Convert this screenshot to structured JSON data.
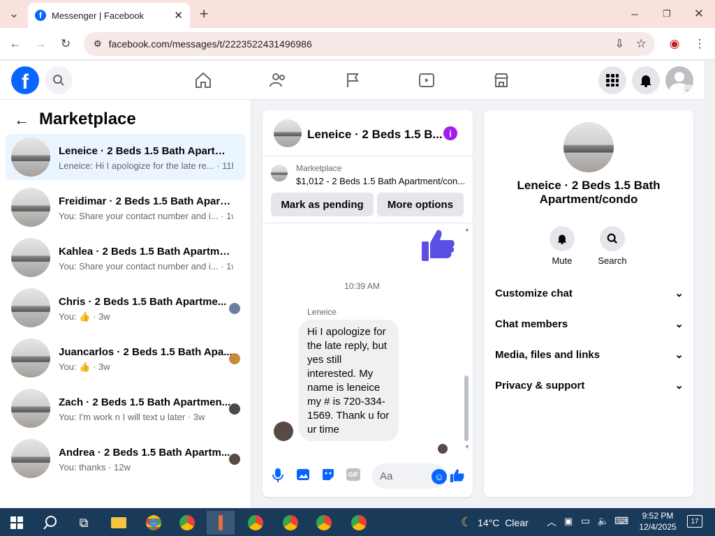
{
  "browser": {
    "tab_title": "Messenger | Facebook",
    "url": "facebook.com/messages/t/2223522431496986"
  },
  "sidebar": {
    "title": "Marketplace",
    "rows": [
      {
        "title": "Leneice · 2 Beds 1.5 Bath Apartme...",
        "preview": "Leneice: Hi I apologize for the late re...",
        "time": "· 11h"
      },
      {
        "title": "Freidimar · 2 Beds 1.5 Bath Apartm...",
        "preview": "You: Share your contact number and i...",
        "time": "· 1w"
      },
      {
        "title": "Kahlea · 2 Beds 1.5 Bath Apartmen...",
        "preview": "You: Share your contact number and i...",
        "time": "· 1w"
      },
      {
        "title": "Chris · 2 Beds 1.5 Bath Apartme...",
        "preview": "You:",
        "time": "· 3w"
      },
      {
        "title": "Juancarlos · 2 Beds 1.5 Bath Apa...",
        "preview": "You:",
        "time": "· 3w"
      },
      {
        "title": "Zach · 2 Beds 1.5 Bath Apartmen...",
        "preview": "You: I'm work n I will text u later",
        "time": "· 3w"
      },
      {
        "title": "Andrea · 2 Beds 1.5 Bath Apartm...",
        "preview": "You: thanks",
        "time": "· 12w"
      }
    ]
  },
  "chat": {
    "header": "Leneice · 2 Beds 1.5 B...",
    "listing_source": "Marketplace",
    "listing_price": "$1,012 - 2 Beds 1.5 Bath Apartment/con...",
    "mark_pending": "Mark as pending",
    "more_options": "More options",
    "timestamp": "10:39 AM",
    "sender": "Leneice",
    "message": "Hi I apologize for the late reply, but yes still interested.  My name is leneice my # is 720-334-1569.  Thank u for ur time",
    "input_placeholder": "Aa"
  },
  "info": {
    "name": "Leneice · 2 Beds 1.5 Bath Apartment/condo",
    "mute": "Mute",
    "search": "Search",
    "sections": [
      "Customize chat",
      "Chat members",
      "Media, files and links",
      "Privacy & support"
    ]
  },
  "taskbar": {
    "weather": "14°C  Clear",
    "time": "9:52 PM",
    "date": "12/4/2025",
    "notif": "17"
  },
  "colors": {
    "fb_blue": "#0866ff",
    "messenger_purple": "#7b2ff7",
    "like_blue": "#5b4fe6"
  }
}
